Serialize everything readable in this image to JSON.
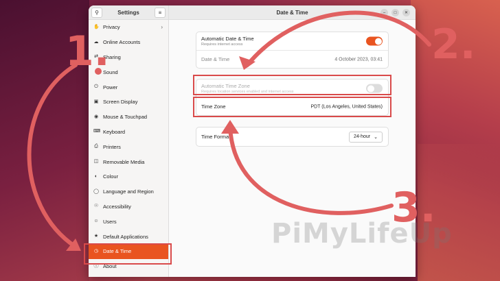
{
  "sidebar": {
    "title": "Settings",
    "search_icon": "search-icon",
    "menu_icon": "hamburger-icon",
    "items": [
      {
        "label": "Privacy",
        "icon": "hand-icon",
        "chevron": "›"
      },
      {
        "label": "Online Accounts",
        "icon": "cloud-icon"
      },
      {
        "label": "Sharing",
        "icon": "share-icon"
      },
      {
        "label": "Sound",
        "icon": "speaker-icon"
      },
      {
        "label": "Power",
        "icon": "power-icon"
      },
      {
        "label": "Screen Display",
        "icon": "monitor-icon"
      },
      {
        "label": "Mouse & Touchpad",
        "icon": "mouse-icon"
      },
      {
        "label": "Keyboard",
        "icon": "keyboard-icon"
      },
      {
        "label": "Printers",
        "icon": "printer-icon"
      },
      {
        "label": "Removable Media",
        "icon": "drive-icon"
      },
      {
        "label": "Colour",
        "icon": "palette-icon"
      },
      {
        "label": "Language and Region",
        "icon": "globe-icon"
      },
      {
        "label": "Accessibility",
        "icon": "accessibility-icon"
      },
      {
        "label": "Users",
        "icon": "user-icon"
      },
      {
        "label": "Default Applications",
        "icon": "star-icon"
      },
      {
        "label": "Date & Time",
        "icon": "clock-icon",
        "active": true
      },
      {
        "label": "About",
        "icon": "info-icon"
      }
    ]
  },
  "main": {
    "title": "Date & Time",
    "card1": {
      "auto_date": {
        "title": "Automatic Date & Time",
        "subtitle": "Requires internet access",
        "toggle": "on"
      },
      "date_time": {
        "title": "Date & Time",
        "value": "4 October 2023, 03:41"
      }
    },
    "card2": {
      "auto_zone": {
        "title": "Automatic Time Zone",
        "subtitle": "Requires location services enabled and internet access",
        "toggle": "off"
      },
      "time_zone": {
        "title": "Time Zone",
        "value": "PDT (Los Angeles, United States)"
      }
    },
    "card3": {
      "time_format": {
        "title": "Time Format",
        "value": "24-hour"
      }
    }
  },
  "annotations": {
    "step1": "1.",
    "step2": "2.",
    "step3": "3."
  },
  "watermark": "PiMyLifeUp",
  "colors": {
    "accent": "#e95420",
    "annotation": "#d94a4a"
  }
}
